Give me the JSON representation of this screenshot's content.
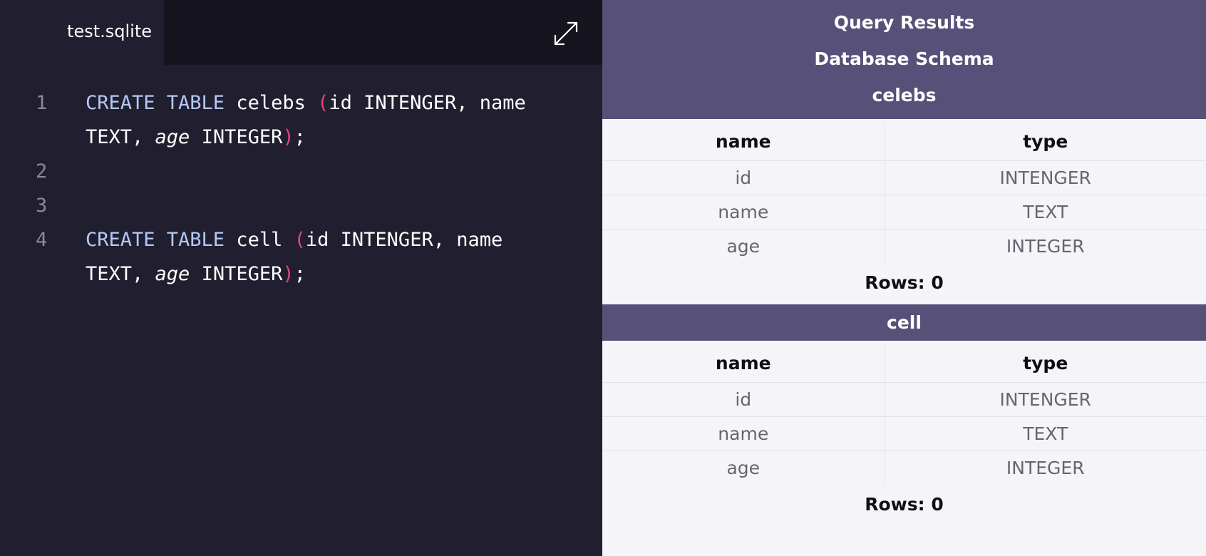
{
  "editor": {
    "tab_label": "test.sqlite",
    "expand_icon": "expand-arrows-icon",
    "lines": [
      {
        "number": "1",
        "keyword": "CREATE TABLE",
        "part1": " celebs ",
        "part2": "id INTENGER, name TEXT, ",
        "italic": "age",
        "part3": " INTEGER",
        "end": ";"
      },
      {
        "number": "2"
      },
      {
        "number": "3"
      },
      {
        "number": "4",
        "keyword": "CREATE TABLE",
        "part1": " cell ",
        "part2": "id INTENGER, name TEXT, ",
        "italic": "age",
        "part3": " INTEGER",
        "end": ";"
      }
    ],
    "open_paren": "(",
    "close_paren": ")",
    "colors": {
      "keyword": "#b4c9f7",
      "paren": "#e2457a",
      "background": "#211f2f"
    }
  },
  "results": {
    "title": "Query Results",
    "subtitle": "Database Schema",
    "tables": [
      {
        "name": "celebs",
        "columns": [
          "name",
          "type"
        ],
        "rows": [
          [
            "id",
            "INTENGER"
          ],
          [
            "name",
            "TEXT"
          ],
          [
            "age",
            "INTEGER"
          ]
        ],
        "row_count": "Rows: 0"
      },
      {
        "name": "cell",
        "columns": [
          "name",
          "type"
        ],
        "rows": [
          [
            "id",
            "INTENGER"
          ],
          [
            "name",
            "TEXT"
          ],
          [
            "age",
            "INTEGER"
          ]
        ],
        "row_count": "Rows: 0"
      }
    ],
    "colors": {
      "header_bar": "#575078",
      "background": "#f5f4f9"
    }
  }
}
